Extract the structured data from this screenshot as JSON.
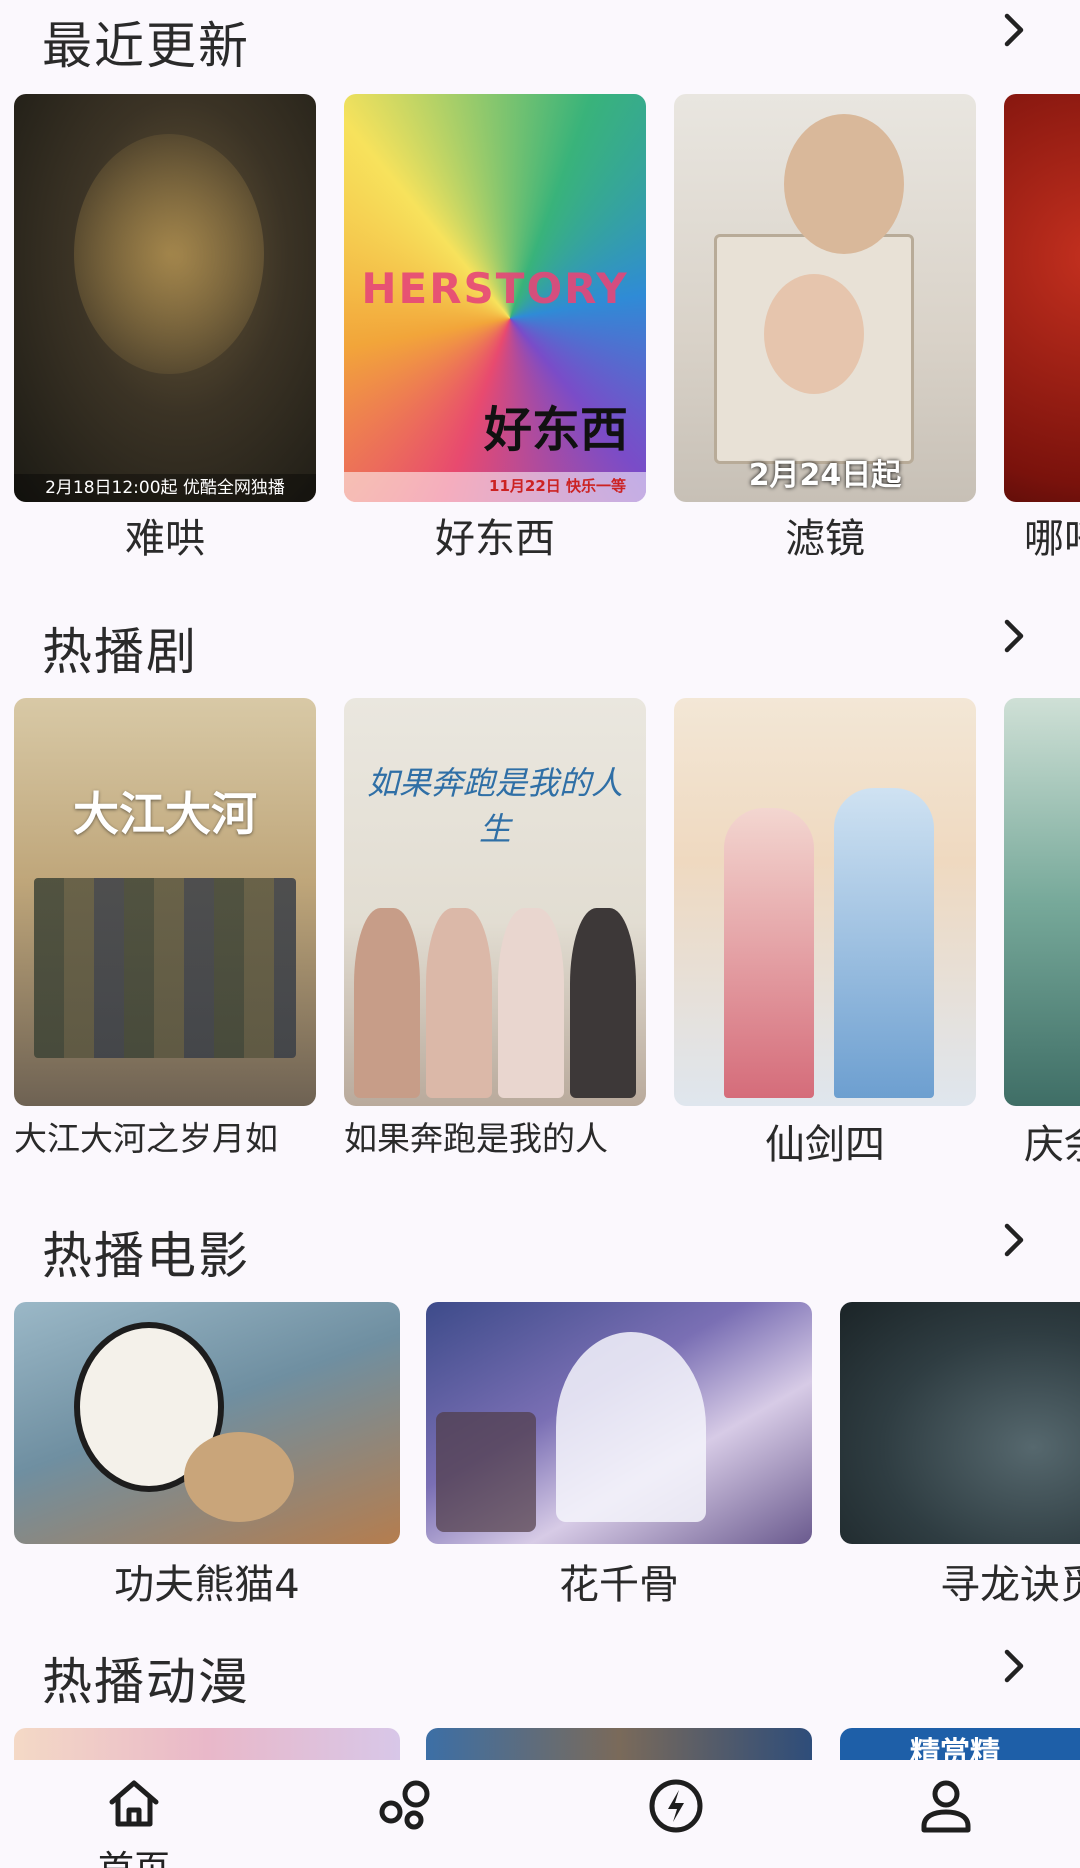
{
  "sections": [
    {
      "title": "最近更新",
      "items": [
        {
          "title": "难哄",
          "poster_text": "2月18日12:00起 优酷全网独播"
        },
        {
          "title": "好东西",
          "poster_text": "11月22日 快乐一等"
        },
        {
          "title": "滤镜",
          "poster_text": "2月24日起"
        },
        {
          "title": "哪吒",
          "poster_text": ""
        }
      ]
    },
    {
      "title": "热播剧",
      "items": [
        {
          "title": "大江大河之岁月如",
          "poster_text": "大江大河"
        },
        {
          "title": "如果奔跑是我的人",
          "poster_text": "如果奔跑是我的人生"
        },
        {
          "title": "仙剑四",
          "poster_text": ""
        },
        {
          "title": "庆余",
          "poster_text": ""
        }
      ]
    },
    {
      "title": "热播电影",
      "items": [
        {
          "title": "功夫熊猫4"
        },
        {
          "title": "花千骨"
        },
        {
          "title": "寻龙诀觅"
        }
      ]
    },
    {
      "title": "热播动漫",
      "items": [
        {
          "title": ""
        },
        {
          "title": ""
        },
        {
          "title": "",
          "poster_text": "精赏精"
        }
      ]
    }
  ],
  "bottom_nav": [
    {
      "label": "首页",
      "icon": "home-icon"
    },
    {
      "label": "",
      "icon": "bubbles-icon"
    },
    {
      "label": "",
      "icon": "lightning-icon"
    },
    {
      "label": "",
      "icon": "profile-icon"
    }
  ],
  "colors": {
    "background": "#fbf8fd",
    "text": "#2a2a2a"
  }
}
